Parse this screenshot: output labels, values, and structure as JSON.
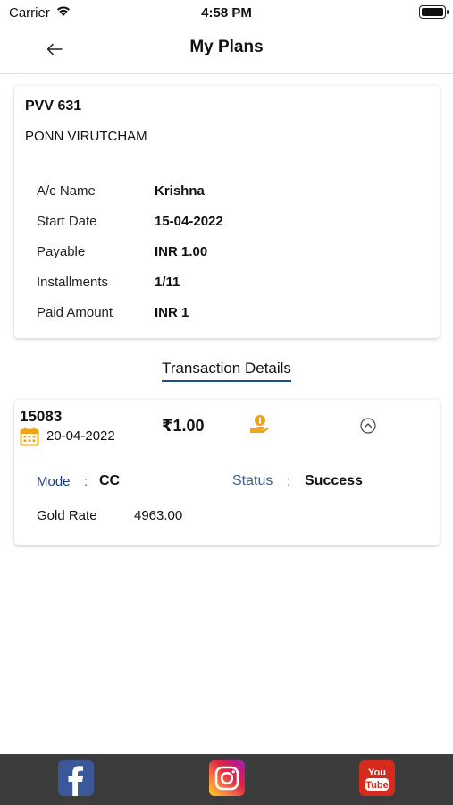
{
  "status_bar": {
    "carrier": "Carrier",
    "time": "4:58 PM"
  },
  "header": {
    "title": "My Plans",
    "back_icon": "arrow-left-icon"
  },
  "plan": {
    "code": "PVV 631",
    "name": "PONN VIRUTCHAM",
    "rows": [
      {
        "label": "A/c Name",
        "value": "Krishna"
      },
      {
        "label": "Start Date",
        "value": "15-04-2022"
      },
      {
        "label": "Payable",
        "value": "INR 1.00"
      },
      {
        "label": "Installments",
        "value": "1/11"
      },
      {
        "label": "Paid Amount",
        "value": "INR 1"
      }
    ]
  },
  "transactions": {
    "heading": "Transaction Details",
    "items": [
      {
        "id": "15083",
        "date": "20-04-2022",
        "amount": "₹1.00",
        "mode_label": "Mode",
        "mode_value": "CC",
        "status_label": "Status",
        "status_value": "Success",
        "separator": ":",
        "gold_rate_label": "Gold Rate",
        "gold_rate_value": "4963.00"
      }
    ]
  },
  "footer": {
    "icons": [
      "facebook-icon",
      "instagram-icon",
      "youtube-icon"
    ],
    "youtube_lines": [
      "You",
      "Tube"
    ]
  },
  "colors": {
    "accent_orange": "#f0a318",
    "link_blue": "#1f3f7a",
    "footer_bg": "#3c3c3c"
  }
}
